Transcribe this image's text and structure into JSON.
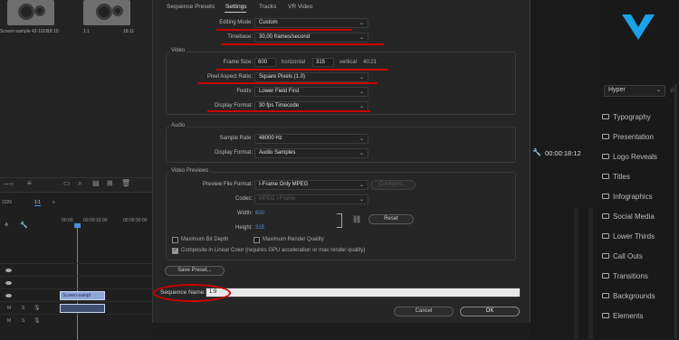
{
  "project": {
    "items": [
      {
        "name": "Screen-sample 42-1026",
        "duration": "18:10"
      },
      {
        "name": "1:1",
        "duration": "18:11"
      }
    ]
  },
  "timeline": {
    "tab_left": "1026",
    "tab_label": "1:1",
    "timecodes": [
      "00:00",
      "00:00:15:00",
      "00:00:30:00"
    ],
    "clip_label": "Screen-sampl",
    "track_letters": [
      "M",
      "S",
      "M",
      "S"
    ]
  },
  "dialog": {
    "tabs": [
      "Sequence Presets",
      "Settings",
      "Tracks",
      "VR Video"
    ],
    "active_tab": "Settings",
    "editing_mode": {
      "label": "Editing Mode:",
      "value": "Custom"
    },
    "timebase": {
      "label": "Timebase:",
      "value": "30,00  frames/second"
    },
    "video_section": "Video",
    "frame_size": {
      "label": "Frame Size:",
      "width": "600",
      "horizontal": "horizontal",
      "height": "315",
      "vertical": "vertical",
      "ratio": "40:21"
    },
    "pixel_aspect": {
      "label": "Pixel Aspect Ratio:",
      "value": "Square Pixels (1.0)"
    },
    "fields": {
      "label": "Fields:",
      "value": "Lower Field First"
    },
    "display_format_video": {
      "label": "Display Format:",
      "value": "30 fps Timecode"
    },
    "audio_section": "Audio",
    "sample_rate": {
      "label": "Sample Rate:",
      "value": "48000 Hz"
    },
    "display_format_audio": {
      "label": "Display Format:",
      "value": "Audio Samples"
    },
    "previews_section": "Video Previews",
    "preview_format": {
      "label": "Preview File Format:",
      "value": "I-Frame Only MPEG",
      "configure": "Configure..."
    },
    "codec": {
      "label": "Codec:",
      "value": "MPEG I-Frame"
    },
    "width": {
      "label": "Width:",
      "value": "600"
    },
    "height": {
      "label": "Height:",
      "value": "315"
    },
    "reset": "Reset",
    "max_bit_depth": "Maximum Bit Depth",
    "max_render_quality": "Maximum Render Quality",
    "linear_color": "Composite in Linear Color (requires GPU acceleration or max render quality)",
    "save_preset": "Save Preset...",
    "sequence_name": {
      "label": "Sequence Name:",
      "value": "1:9"
    },
    "cancel": "Cancel",
    "ok": "OK"
  },
  "monitor": {
    "timecode": "00:00:18:12"
  },
  "effects": {
    "dropdown": "Hyper",
    "categories": [
      "Typography",
      "Presentation",
      "Logo Reveals",
      "Titles",
      "Infographics",
      "Social Media",
      "Lower Thirds",
      "Call Outs",
      "Transitions",
      "Backgrounds",
      "Elements"
    ]
  },
  "colors": {
    "annotation": "#cc0000",
    "accent_blue": "#4e8ee2"
  }
}
